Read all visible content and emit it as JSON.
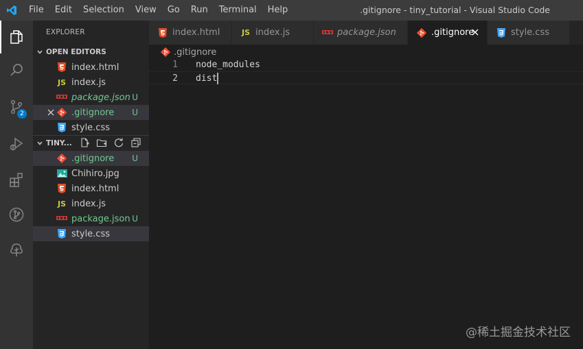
{
  "window": {
    "title": ".gitignore - tiny_tutorial - Visual Studio Code"
  },
  "menu": [
    "File",
    "Edit",
    "Selection",
    "View",
    "Go",
    "Run",
    "Terminal",
    "Help"
  ],
  "activity_bar": {
    "items": [
      "explorer-icon",
      "search-icon",
      "source-control-icon",
      "run-debug-icon",
      "extensions-icon",
      "git-graph-icon",
      "tree-icon"
    ],
    "source_control_badge": "2"
  },
  "sidebar": {
    "title": "EXPLORER",
    "open_editors": {
      "label": "OPEN EDITORS",
      "items": [
        {
          "name": "index.html",
          "icon": "html-icon",
          "status": ""
        },
        {
          "name": "index.js",
          "icon": "js-icon",
          "status": ""
        },
        {
          "name": "package.json",
          "icon": "npm-icon",
          "status": "U"
        },
        {
          "name": ".gitignore",
          "icon": "git-icon",
          "status": "U"
        },
        {
          "name": "style.css",
          "icon": "css-icon",
          "status": ""
        }
      ]
    },
    "folder": {
      "label": "TINY...",
      "items": [
        {
          "name": ".gitignore",
          "icon": "git-icon",
          "status": "U"
        },
        {
          "name": "Chihiro.jpg",
          "icon": "image-icon",
          "status": ""
        },
        {
          "name": "index.html",
          "icon": "html-icon",
          "status": ""
        },
        {
          "name": "index.js",
          "icon": "js-icon",
          "status": ""
        },
        {
          "name": "package.json",
          "icon": "npm-icon",
          "status": "U"
        },
        {
          "name": "style.css",
          "icon": "css-icon",
          "status": ""
        }
      ]
    }
  },
  "tabs": [
    {
      "label": "index.html",
      "icon": "html-icon"
    },
    {
      "label": "index.js",
      "icon": "js-icon"
    },
    {
      "label": "package.json",
      "icon": "npm-icon"
    },
    {
      "label": ".gitignore",
      "icon": "git-icon"
    },
    {
      "label": "style.css",
      "icon": "css-icon"
    }
  ],
  "editor": {
    "breadcrumb": ".gitignore",
    "lines": [
      {
        "number": "1",
        "text": "node_modules"
      },
      {
        "number": "2",
        "text": "dist"
      }
    ]
  },
  "watermark": "@稀土掘金技术社区",
  "colors": {
    "git_untracked": "#73c991",
    "accent": "#007acc",
    "html": "#e44d26",
    "js": "#cbcb41",
    "css": "#42a5f5",
    "git": "#f14e32",
    "npm": "#cb3837"
  }
}
